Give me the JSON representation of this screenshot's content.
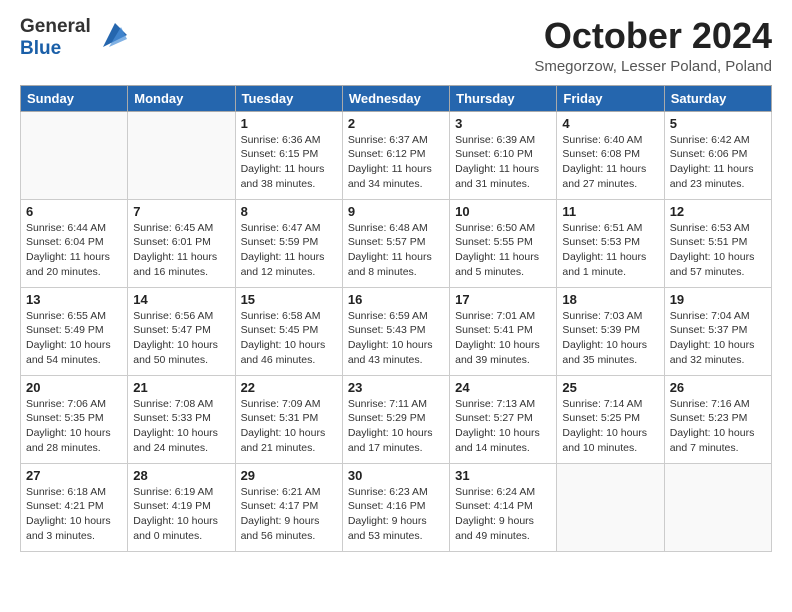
{
  "header": {
    "logo_general": "General",
    "logo_blue": "Blue",
    "month_title": "October 2024",
    "location": "Smegorzow, Lesser Poland, Poland"
  },
  "calendar": {
    "days_of_week": [
      "Sunday",
      "Monday",
      "Tuesday",
      "Wednesday",
      "Thursday",
      "Friday",
      "Saturday"
    ],
    "weeks": [
      [
        {
          "day": "",
          "info": ""
        },
        {
          "day": "",
          "info": ""
        },
        {
          "day": "1",
          "info": "Sunrise: 6:36 AM\nSunset: 6:15 PM\nDaylight: 11 hours and 38 minutes."
        },
        {
          "day": "2",
          "info": "Sunrise: 6:37 AM\nSunset: 6:12 PM\nDaylight: 11 hours and 34 minutes."
        },
        {
          "day": "3",
          "info": "Sunrise: 6:39 AM\nSunset: 6:10 PM\nDaylight: 11 hours and 31 minutes."
        },
        {
          "day": "4",
          "info": "Sunrise: 6:40 AM\nSunset: 6:08 PM\nDaylight: 11 hours and 27 minutes."
        },
        {
          "day": "5",
          "info": "Sunrise: 6:42 AM\nSunset: 6:06 PM\nDaylight: 11 hours and 23 minutes."
        }
      ],
      [
        {
          "day": "6",
          "info": "Sunrise: 6:44 AM\nSunset: 6:04 PM\nDaylight: 11 hours and 20 minutes."
        },
        {
          "day": "7",
          "info": "Sunrise: 6:45 AM\nSunset: 6:01 PM\nDaylight: 11 hours and 16 minutes."
        },
        {
          "day": "8",
          "info": "Sunrise: 6:47 AM\nSunset: 5:59 PM\nDaylight: 11 hours and 12 minutes."
        },
        {
          "day": "9",
          "info": "Sunrise: 6:48 AM\nSunset: 5:57 PM\nDaylight: 11 hours and 8 minutes."
        },
        {
          "day": "10",
          "info": "Sunrise: 6:50 AM\nSunset: 5:55 PM\nDaylight: 11 hours and 5 minutes."
        },
        {
          "day": "11",
          "info": "Sunrise: 6:51 AM\nSunset: 5:53 PM\nDaylight: 11 hours and 1 minute."
        },
        {
          "day": "12",
          "info": "Sunrise: 6:53 AM\nSunset: 5:51 PM\nDaylight: 10 hours and 57 minutes."
        }
      ],
      [
        {
          "day": "13",
          "info": "Sunrise: 6:55 AM\nSunset: 5:49 PM\nDaylight: 10 hours and 54 minutes."
        },
        {
          "day": "14",
          "info": "Sunrise: 6:56 AM\nSunset: 5:47 PM\nDaylight: 10 hours and 50 minutes."
        },
        {
          "day": "15",
          "info": "Sunrise: 6:58 AM\nSunset: 5:45 PM\nDaylight: 10 hours and 46 minutes."
        },
        {
          "day": "16",
          "info": "Sunrise: 6:59 AM\nSunset: 5:43 PM\nDaylight: 10 hours and 43 minutes."
        },
        {
          "day": "17",
          "info": "Sunrise: 7:01 AM\nSunset: 5:41 PM\nDaylight: 10 hours and 39 minutes."
        },
        {
          "day": "18",
          "info": "Sunrise: 7:03 AM\nSunset: 5:39 PM\nDaylight: 10 hours and 35 minutes."
        },
        {
          "day": "19",
          "info": "Sunrise: 7:04 AM\nSunset: 5:37 PM\nDaylight: 10 hours and 32 minutes."
        }
      ],
      [
        {
          "day": "20",
          "info": "Sunrise: 7:06 AM\nSunset: 5:35 PM\nDaylight: 10 hours and 28 minutes."
        },
        {
          "day": "21",
          "info": "Sunrise: 7:08 AM\nSunset: 5:33 PM\nDaylight: 10 hours and 24 minutes."
        },
        {
          "day": "22",
          "info": "Sunrise: 7:09 AM\nSunset: 5:31 PM\nDaylight: 10 hours and 21 minutes."
        },
        {
          "day": "23",
          "info": "Sunrise: 7:11 AM\nSunset: 5:29 PM\nDaylight: 10 hours and 17 minutes."
        },
        {
          "day": "24",
          "info": "Sunrise: 7:13 AM\nSunset: 5:27 PM\nDaylight: 10 hours and 14 minutes."
        },
        {
          "day": "25",
          "info": "Sunrise: 7:14 AM\nSunset: 5:25 PM\nDaylight: 10 hours and 10 minutes."
        },
        {
          "day": "26",
          "info": "Sunrise: 7:16 AM\nSunset: 5:23 PM\nDaylight: 10 hours and 7 minutes."
        }
      ],
      [
        {
          "day": "27",
          "info": "Sunrise: 6:18 AM\nSunset: 4:21 PM\nDaylight: 10 hours and 3 minutes."
        },
        {
          "day": "28",
          "info": "Sunrise: 6:19 AM\nSunset: 4:19 PM\nDaylight: 10 hours and 0 minutes."
        },
        {
          "day": "29",
          "info": "Sunrise: 6:21 AM\nSunset: 4:17 PM\nDaylight: 9 hours and 56 minutes."
        },
        {
          "day": "30",
          "info": "Sunrise: 6:23 AM\nSunset: 4:16 PM\nDaylight: 9 hours and 53 minutes."
        },
        {
          "day": "31",
          "info": "Sunrise: 6:24 AM\nSunset: 4:14 PM\nDaylight: 9 hours and 49 minutes."
        },
        {
          "day": "",
          "info": ""
        },
        {
          "day": "",
          "info": ""
        }
      ]
    ]
  }
}
